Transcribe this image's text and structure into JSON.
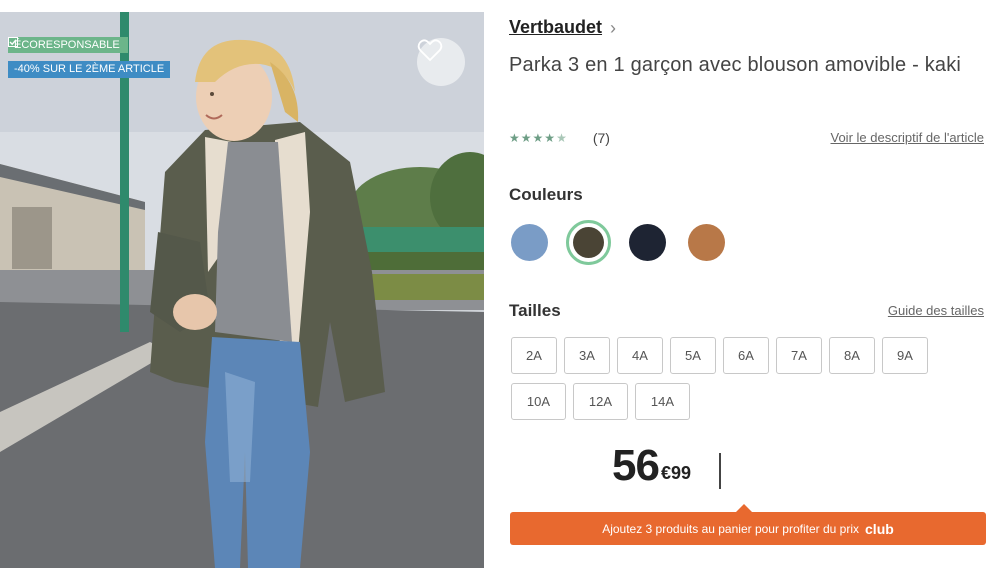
{
  "product_image": {
    "badge_eco": "ÉCORESPONSABLE",
    "badge_promo": "-40% SUR LE 2ÈME ARTICLE",
    "favorite_icon": "heart-icon",
    "check_icon": "check-icon"
  },
  "brand": {
    "name": "Vertbaudet",
    "chevron": "›"
  },
  "title": "Parka 3 en 1 garçon avec blouson amovible - kaki",
  "rating": {
    "value": 4.5,
    "max": 5,
    "count": "(7)"
  },
  "description_link": "Voir le descriptif de l'article",
  "colors": {
    "label": "Couleurs",
    "swatches": [
      {
        "name": "blue",
        "hex": "#7a9cc6",
        "selected": false
      },
      {
        "name": "khaki",
        "hex": "#4a4435",
        "selected": true
      },
      {
        "name": "navy",
        "hex": "#1e2433",
        "selected": false
      },
      {
        "name": "camel",
        "hex": "#b87848",
        "selected": false
      }
    ],
    "selected_ring": "#7fc99b"
  },
  "sizes": {
    "label": "Tailles",
    "guide_link": "Guide des tailles",
    "options": [
      "2A",
      "3A",
      "4A",
      "5A",
      "6A",
      "7A",
      "8A",
      "9A",
      "10A",
      "12A",
      "14A"
    ]
  },
  "price": {
    "integer": "56",
    "decimal": "€99"
  },
  "club_banner": {
    "text": "Ajoutez 3 produits au panier pour profiter du prix",
    "club_word": "club",
    "color": "#e8692f"
  }
}
